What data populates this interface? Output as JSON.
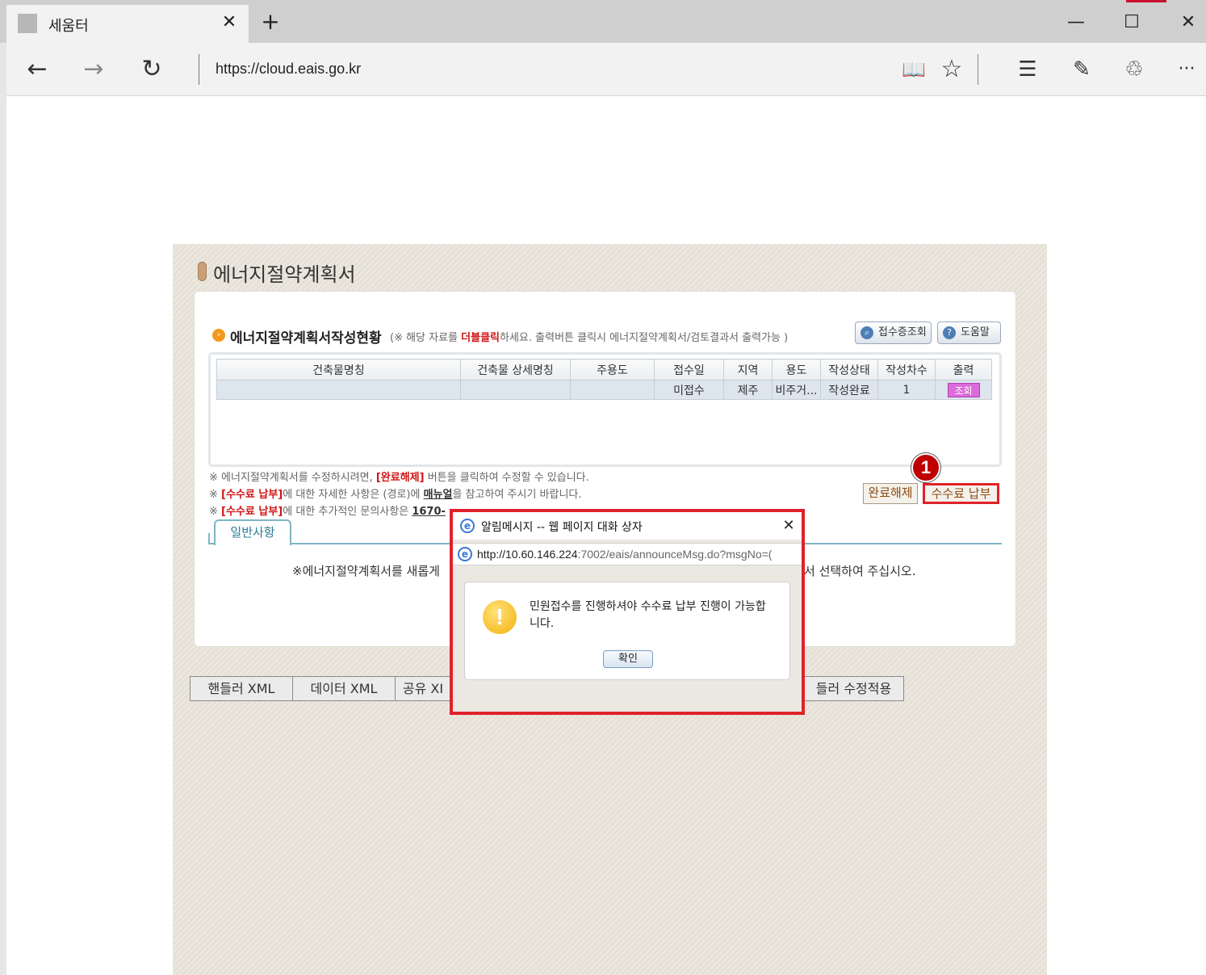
{
  "browser": {
    "tab_title": "세움터",
    "tab_close": "✕",
    "new_tab": "+",
    "minimize": "—",
    "maximize": "☐",
    "close": "✕",
    "address": "https://cloud.eais.go.kr",
    "back": "←",
    "forward": "→",
    "refresh": "↻",
    "reading_view": "📖",
    "favorite": "☆",
    "hub": "☰",
    "notes": "✎",
    "share": "♲",
    "more": "···"
  },
  "page": {
    "title": "에너지절약계획서",
    "section_title": "에너지절약계획서작성현황",
    "section_note_pre": "(※ 해당 자료를 ",
    "section_note_emph": "더블클릭",
    "section_note_post": "하세요. 출력버튼 클릭시 에너지절약계획서/검토결과서 출력가능 )",
    "btn_receipt": "접수증조회",
    "btn_help": "도움말",
    "grid": {
      "headers": [
        "건축물명칭",
        "건축물 상세명칭",
        "주용도",
        "접수일",
        "지역",
        "용도",
        "작성상태",
        "작성차수",
        "출력"
      ],
      "rows": [
        [
          "",
          "",
          "",
          "미접수",
          "제주",
          "비주거...",
          "작성완료",
          "1",
          "조회"
        ]
      ]
    },
    "notices": {
      "line1_a": "※ 에너지절약계획서를 수정하시려면, ",
      "line1_b": "[완료해제]",
      "line1_c": " 버튼을 클릭하여 수정할 수 있습니다.",
      "line2_a": "※ ",
      "line2_b": "[수수료 납부]",
      "line2_c": "에 대한 자세한 사항은 (경로)에 ",
      "line2_d": "매뉴얼",
      "line2_e": "을 참고하여 주시기 바랍니다.",
      "line3_a": "※ ",
      "line3_b": "[수수료 납부]",
      "line3_c": "에 대한 추가적인 문의사항은 ",
      "line3_d": "1670-"
    },
    "btn_release": "완료해제",
    "btn_pay": "수수료 납부",
    "marker": "1",
    "subtab": "일반사항",
    "guide_left": "※에너지절약계획서를 새롭게",
    "guide_right": "서 선택하여 주십시오.",
    "bottom_buttons": [
      "핸들러 XML",
      "데이터 XML",
      "공유 XI",
      "들러 수정적용"
    ]
  },
  "dialog": {
    "title": "알림메시지 -- 웹 페이지 대화 상자",
    "close": "✕",
    "url_host": "http://10.60.146.224",
    "url_rest": ":7002/eais/announceMsg.do?msgNo=(",
    "message": "민원접수를 진행하셔야 수수료 납부 진행이 가능합니다.",
    "ok": "확인",
    "warn_glyph": "!"
  }
}
